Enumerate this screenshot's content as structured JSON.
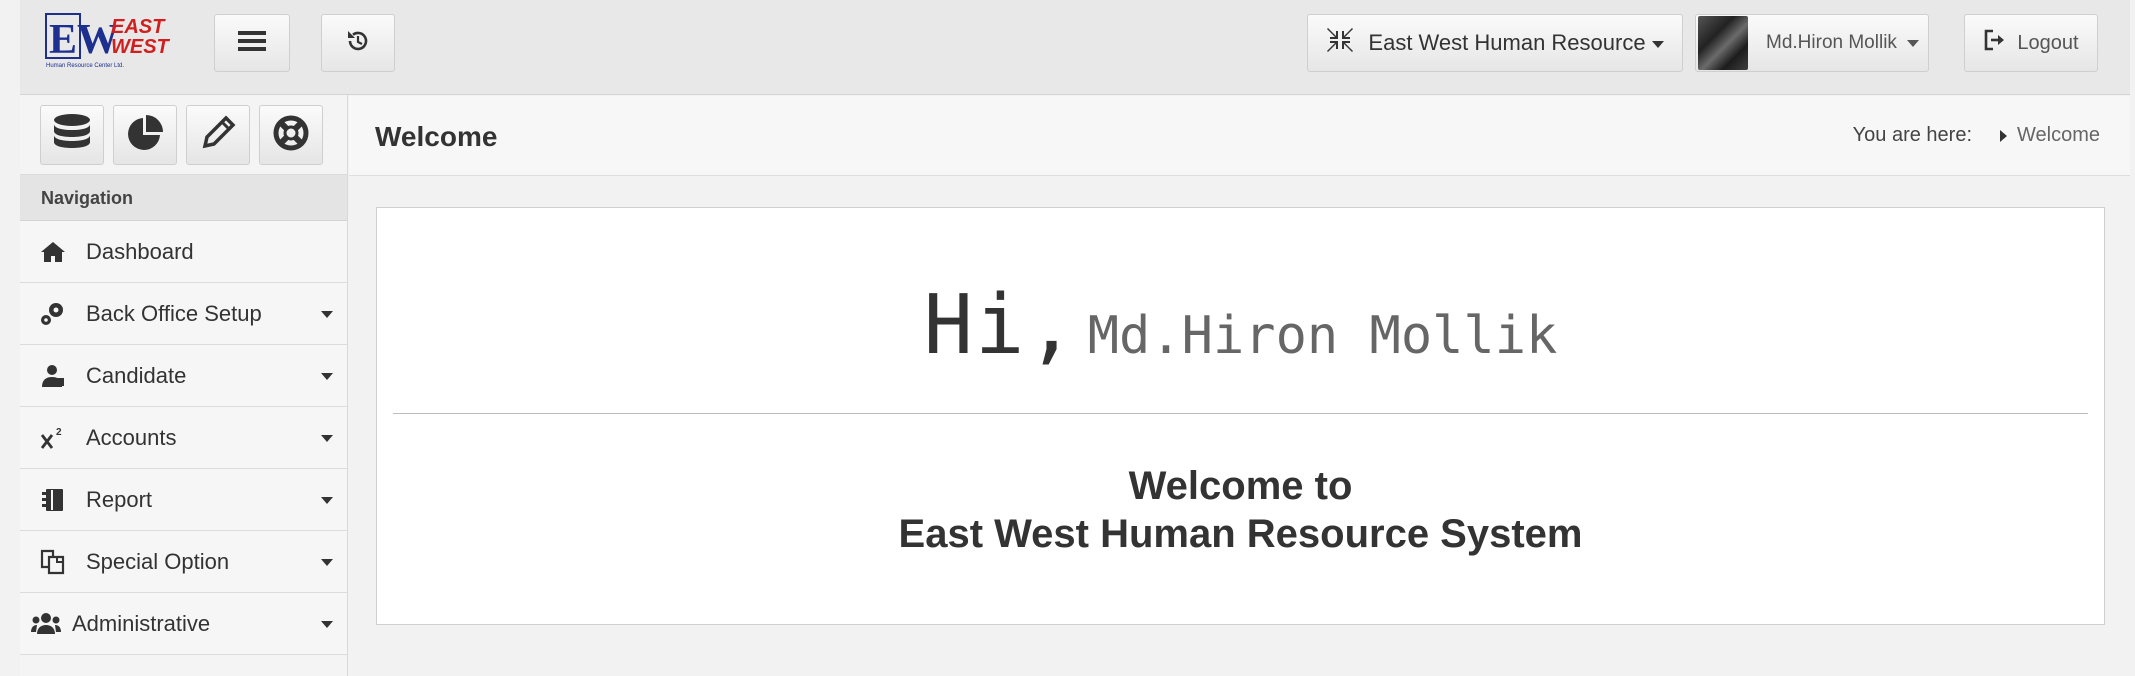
{
  "brand": {
    "logo_letters": "EW",
    "logo_line1": "EAST",
    "logo_line2": "WEST",
    "logo_tagline": "Human Resource Center Ltd.",
    "logo_icon": "company-logo",
    "colors": {
      "blue": "#1d2f8f",
      "red": "#d11f1f"
    }
  },
  "header": {
    "menu_icon": "hamburger-icon",
    "history_icon": "history-icon",
    "company_icon": "compress-arrows-icon",
    "company_label": "East West Human Resource",
    "user_label": "Md.Hiron Mollik",
    "logout_icon": "sign-out-icon",
    "logout_label": "Logout"
  },
  "toolbar": {
    "tools": [
      "database-icon",
      "pie-chart-icon",
      "pencil-icon",
      "life-ring-icon"
    ]
  },
  "sidebar": {
    "heading": "Navigation",
    "items": [
      {
        "label": "Dashboard",
        "icon": "home-icon",
        "has_dropdown": false
      },
      {
        "label": "Back Office Setup",
        "icon": "cogs-icon",
        "has_dropdown": true
      },
      {
        "label": "Candidate",
        "icon": "user-tie-icon",
        "has_dropdown": true
      },
      {
        "label": "Accounts",
        "icon": "superscript-icon",
        "has_dropdown": true
      },
      {
        "label": "Report",
        "icon": "address-book-icon",
        "has_dropdown": true
      },
      {
        "label": "Special Option",
        "icon": "copy-icon",
        "has_dropdown": true
      },
      {
        "label": "Administrative",
        "icon": "users-icon",
        "has_dropdown": true
      }
    ]
  },
  "page": {
    "title": "Welcome",
    "breadcrumb_prefix": "You are here:",
    "breadcrumb_current": "Welcome"
  },
  "greeting": {
    "hi": "Hi,",
    "name": "Md.Hiron Mollik",
    "welcome_line1": "Welcome to",
    "welcome_line2": "East West Human Resource System"
  }
}
